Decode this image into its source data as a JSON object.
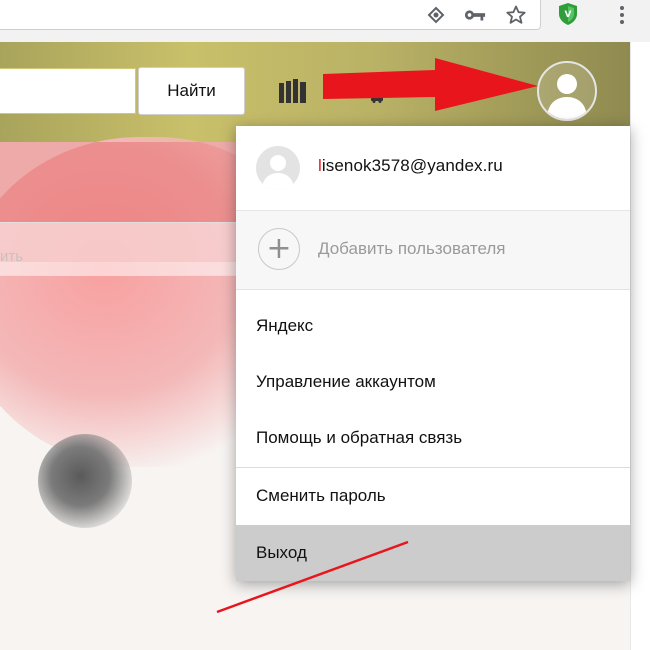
{
  "browser": {
    "icons": [
      "translate-icon",
      "key-icon",
      "star-icon",
      "shield-extension-icon",
      "menu-dots-icon"
    ]
  },
  "header": {
    "find_label": "Найти",
    "search_placeholder": ""
  },
  "background": {
    "ghost_text": "ить"
  },
  "account_menu": {
    "email": "lisenok3578@yandex.ru",
    "email_first_letter_color": "#e02020",
    "add_user_label": "Добавить пользователя",
    "items": [
      {
        "label": "Яндекс"
      },
      {
        "label": "Управление аккаунтом"
      },
      {
        "label": "Помощь и обратная связь"
      },
      {
        "label": "Сменить пароль"
      },
      {
        "label": "Выход",
        "highlighted": true
      }
    ]
  },
  "colors": {
    "annotation_red": "#e8161c",
    "highlight_gray": "#cccccc"
  }
}
